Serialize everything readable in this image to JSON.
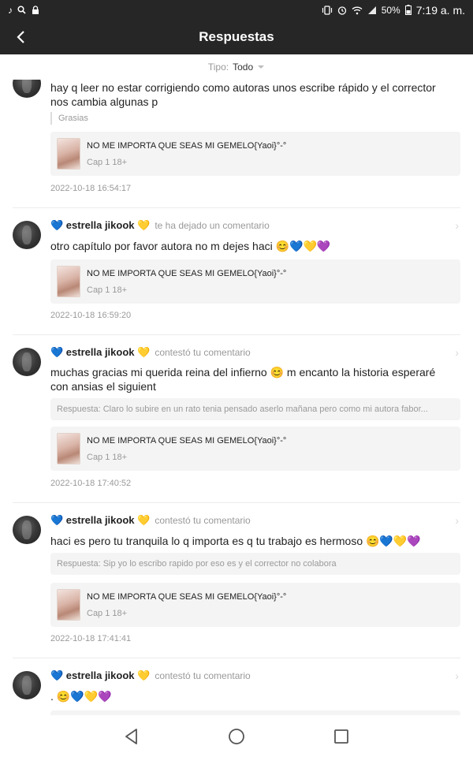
{
  "status_bar": {
    "battery_percent": "50%",
    "time": "7:19 a. m.",
    "left_icons": [
      "tiktok-icon",
      "search-icon",
      "lock-icon"
    ],
    "right_icons": [
      "vibrate-icon",
      "alarm-icon",
      "wifi-icon",
      "signal-icon",
      "battery-icon"
    ]
  },
  "app_bar": {
    "title": "Respuestas",
    "back_icon": "back-arrow-icon"
  },
  "filter": {
    "label": "Tipo:",
    "value": "Todo"
  },
  "entries": [
    {
      "comment": "hay q leer no estar corrigiendo como autoras unos escribe rápido y el corrector nos cambia algunas p",
      "quote": "Grasias",
      "chapter": {
        "title": "NO ME IMPORTA QUE SEAS MI GEMELO{Yaoi}°-°",
        "subtitle": "Cap 1 18+"
      },
      "timestamp": "2022-10-18 16:54:17"
    },
    {
      "user": "💙 estrella jikook 💛",
      "action": "te ha dejado un comentario",
      "comment": "otro capítulo por favor autora no m dejes haci 😊💙💛💜",
      "chapter": {
        "title": "NO ME IMPORTA QUE SEAS MI GEMELO{Yaoi}°-°",
        "subtitle": "Cap 1 18+"
      },
      "timestamp": "2022-10-18 16:59:20"
    },
    {
      "user": "💙 estrella jikook 💛",
      "action": "contestó tu comentario",
      "comment": "muchas gracias mi querida reina del infierno 😊 m encanto la historia esperaré con ansias el siguient",
      "reply": "Respuesta: Claro lo subire en un rato tenia pensado aserlo mañana pero como mi autora fabor...",
      "chapter": {
        "title": "NO ME IMPORTA QUE SEAS MI GEMELO{Yaoi}°-°",
        "subtitle": "Cap 1 18+"
      },
      "timestamp": "2022-10-18 17:40:52"
    },
    {
      "user": "💙 estrella jikook 💛",
      "action": "contestó tu comentario",
      "comment": "haci es pero tu tranquila lo q importa es q tu trabajo es hermoso 😊💙💛💜",
      "reply": "Respuesta: Sip yo lo escribo rapido por eso es y el corrector no colabora",
      "chapter": {
        "title": "NO ME IMPORTA QUE SEAS MI GEMELO{Yaoi}°-°",
        "subtitle": "Cap 1 18+"
      },
      "timestamp": "2022-10-18 17:41:41"
    },
    {
      "user": "💙 estrella jikook 💛",
      "action": "contestó tu comentario",
      "comment": ". 😊💙💛💜"
    }
  ],
  "colors": {
    "header_bg": "#262626",
    "card_bg": "#f4f4f4",
    "muted_text": "#999999"
  }
}
